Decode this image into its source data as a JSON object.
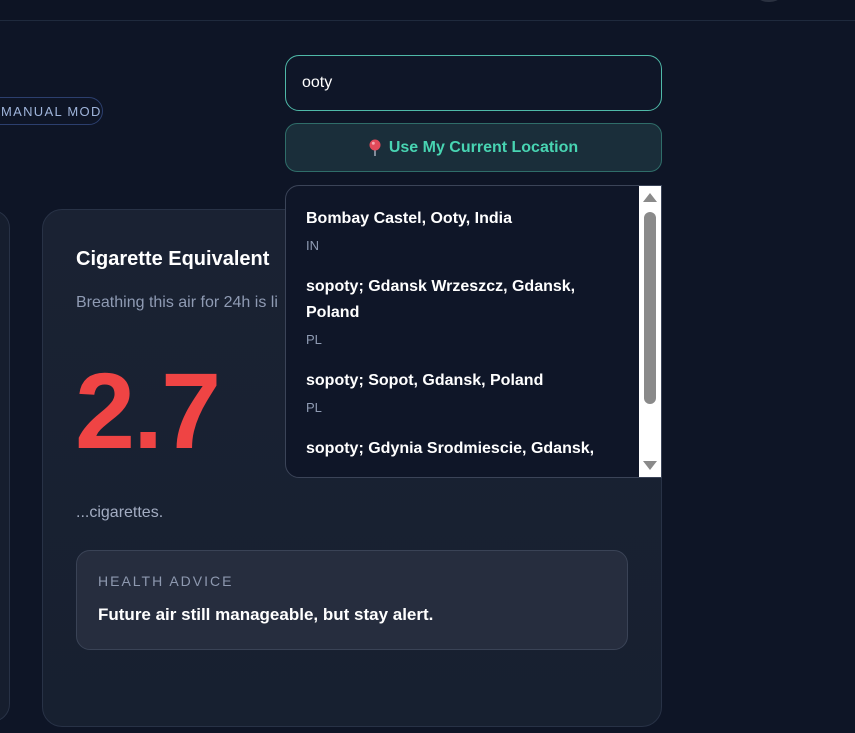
{
  "mode_badge": "MANUAL MODE",
  "search": {
    "value": "ooty"
  },
  "location_button": {
    "label": "Use My Current Location",
    "icon": "pin-icon"
  },
  "results": [
    {
      "name": "Bombay Castel, Ooty, India",
      "code": "IN"
    },
    {
      "name": "sopoty; Gdansk Wrzeszcz, Gdansk, Poland",
      "code": "PL"
    },
    {
      "name": "sopoty; Sopot, Gdansk, Poland",
      "code": "PL"
    },
    {
      "name": "sopoty; Gdynia Srodmiescie, Gdansk,",
      "code": ""
    }
  ],
  "card": {
    "title": "Cigarette Equivalent",
    "subtitle": "Breathing this air for 24h is li",
    "value": "2.7",
    "unit_text": "...cigarettes.",
    "advice_label": "HEALTH ADVICE",
    "advice_text": "Future air still manageable, but stay alert."
  },
  "colors": {
    "accent": "#48d4b2",
    "danger": "#ef4444",
    "background": "#0e1526"
  }
}
